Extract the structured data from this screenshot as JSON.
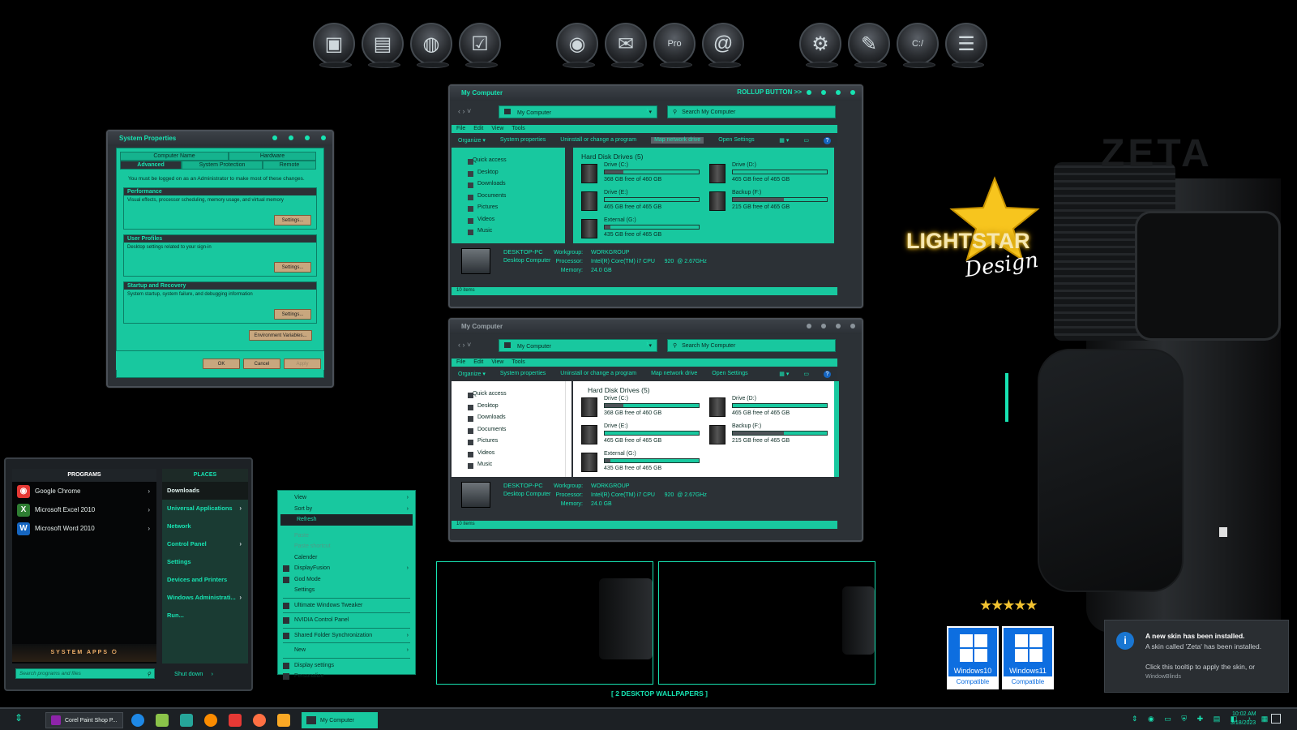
{
  "dock": {
    "icons": [
      {
        "name": "computer-icon",
        "glyph": "▣"
      },
      {
        "name": "documents-icon",
        "glyph": "▤"
      },
      {
        "name": "network-icon",
        "glyph": "◍"
      },
      {
        "name": "calendar-check-icon",
        "glyph": "☑"
      },
      {
        "name": "chrome-icon",
        "glyph": "◉"
      },
      {
        "name": "thunderbird-icon",
        "glyph": "✉"
      },
      {
        "name": "pro-icon",
        "glyph": "Pro"
      },
      {
        "name": "address-book-icon",
        "glyph": "@"
      },
      {
        "name": "settings-icon",
        "glyph": "⚙"
      },
      {
        "name": "edit-icon",
        "glyph": "✎"
      },
      {
        "name": "cmd-icon",
        "glyph": "C:/"
      },
      {
        "name": "stack-icon",
        "glyph": "☰"
      }
    ]
  },
  "explorer_top": {
    "title": "My Computer",
    "rollup": "ROLLUP BUTTON >>",
    "address": "My Computer",
    "search": "Search My Computer",
    "menu": [
      "File",
      "Edit",
      "View",
      "Tools"
    ],
    "commands": [
      "Organize ▾",
      "System properties",
      "Uninstall or change a program",
      "Map network drive",
      "Open Settings"
    ],
    "nav": [
      "Quick access",
      "Desktop",
      "Downloads",
      "Documents",
      "Pictures",
      "Videos",
      "Music"
    ],
    "section": "Hard Disk Drives (5)",
    "drives": [
      {
        "name": "Drive (C:)",
        "free": "368 GB free of 460 GB",
        "used": 0.2
      },
      {
        "name": "Drive (D:)",
        "free": "465 GB free of 465 GB",
        "used": 0.0
      },
      {
        "name": "Drive (E:)",
        "free": "465 GB free of 465 GB",
        "used": 0.0
      },
      {
        "name": "Backup (F:)",
        "free": "215 GB free of 465 GB",
        "used": 0.54
      },
      {
        "name": "External (G:)",
        "free": "435 GB free of 465 GB",
        "used": 0.06
      }
    ],
    "pc_name": "DESKTOP-PC",
    "pc_desc": "Desktop Computer",
    "workgroup_label": "Workgroup:",
    "workgroup": "WORKGROUP",
    "processor_label": "Processor:",
    "processor": "Intel(R) Core(TM) i7 CPU      920  @ 2.67GHz",
    "memory_label": "Memory:",
    "memory": "24.0 GB",
    "status": "10 items"
  },
  "explorer_bottom": {
    "title": "My Computer",
    "address": "My Computer",
    "search": "Search My Computer",
    "section": "Hard Disk Drives (5)"
  },
  "sysprops": {
    "title": "System Properties",
    "tabs_top": [
      "Computer Name",
      "Hardware"
    ],
    "tabs_bottom": [
      "Advanced",
      "System Protection",
      "Remote"
    ],
    "notice": "You must be logged on as an Administrator to make most of these changes.",
    "groups": [
      {
        "title": "Performance",
        "text": "Visual effects, processor scheduling, memory usage, and virtual memory",
        "button": "Settings..."
      },
      {
        "title": "User Profiles",
        "text": "Desktop settings related to your sign-in",
        "button": "Settings..."
      },
      {
        "title": "Startup and Recovery",
        "text": "System startup, system failure, and debugging information",
        "button": "Settings..."
      }
    ],
    "env_button": "Environment Variables...",
    "ok": "OK",
    "cancel": "Cancel",
    "apply": "Apply"
  },
  "startmenu": {
    "programs_header": "PROGRAMS",
    "places_header": "PLACES",
    "programs": [
      {
        "label": "Google Chrome",
        "color": "#e53935",
        "glyph": "◉"
      },
      {
        "label": "Microsoft Excel 2010",
        "color": "#2e7d32",
        "glyph": "X"
      },
      {
        "label": "Microsoft Word 2010",
        "color": "#1565c0",
        "glyph": "W"
      }
    ],
    "places": [
      {
        "label": "Downloads",
        "arrow": false
      },
      {
        "label": "Universal Applications",
        "arrow": true
      },
      {
        "label": "Network",
        "arrow": false
      },
      {
        "label": "Control Panel",
        "arrow": true
      },
      {
        "label": "Settings",
        "arrow": false
      },
      {
        "label": "Devices and Printers",
        "arrow": false
      },
      {
        "label": "Windows Administrati...",
        "arrow": true
      },
      {
        "label": "Run...",
        "arrow": false
      }
    ],
    "system_apps": "SYSTEM APPS",
    "search_placeholder": "Search programs and files",
    "shutdown": "Shut down"
  },
  "context_menu": {
    "items": [
      {
        "label": "View",
        "arrow": true,
        "state": ""
      },
      {
        "label": "Sort by",
        "arrow": true,
        "state": ""
      },
      {
        "label": "Refresh",
        "arrow": false,
        "state": "sel"
      },
      {
        "label": "Paste",
        "arrow": false,
        "state": "dis",
        "gap": true
      },
      {
        "label": "Paste shortcut",
        "arrow": false,
        "state": "dis"
      },
      {
        "label": "Calender",
        "arrow": false,
        "state": ""
      },
      {
        "label": "DisplayFusion",
        "arrow": true,
        "state": "",
        "icon": true
      },
      {
        "label": "God Mode",
        "arrow": false,
        "state": "",
        "icon": true
      },
      {
        "label": "Settings",
        "arrow": false,
        "state": ""
      },
      {
        "label": "Ultimate Windows Tweaker",
        "arrow": false,
        "state": "",
        "icon": true,
        "sep": true
      },
      {
        "label": "NVIDIA Control Panel",
        "arrow": false,
        "state": "",
        "icon": true,
        "sep": true
      },
      {
        "label": "Shared Folder Synchronization",
        "arrow": true,
        "state": "",
        "icon": true,
        "sep": true
      },
      {
        "label": "New",
        "arrow": true,
        "state": "",
        "sep": true
      },
      {
        "label": "Display settings",
        "arrow": false,
        "state": "",
        "icon": true,
        "sep": true
      },
      {
        "label": "Personalize",
        "arrow": false,
        "state": "",
        "icon": true
      }
    ]
  },
  "branding": {
    "zeta": "ZETA",
    "lightstar": "LIGHTSTAR",
    "design": "Design",
    "wallpapers": "[ 2 DESKTOP WALLPAPERS ]",
    "win10": "Windows10",
    "win11": "Windows11",
    "compatible": "Compatible"
  },
  "toast": {
    "title": "A new skin has been installed.",
    "body": "A skin called 'Zeta' has been installed.",
    "action": "Click this tooltip to apply the skin, or",
    "source": "WindowBlinds"
  },
  "taskbar": {
    "task1": "Corel Paint Shop P...",
    "task2": "My Computer",
    "time": "10:02 AM",
    "date": "3/18/2023"
  },
  "colors": {
    "accent": "#18c89f",
    "accent_text": "#17e3b2",
    "dark": "#2c3136"
  }
}
